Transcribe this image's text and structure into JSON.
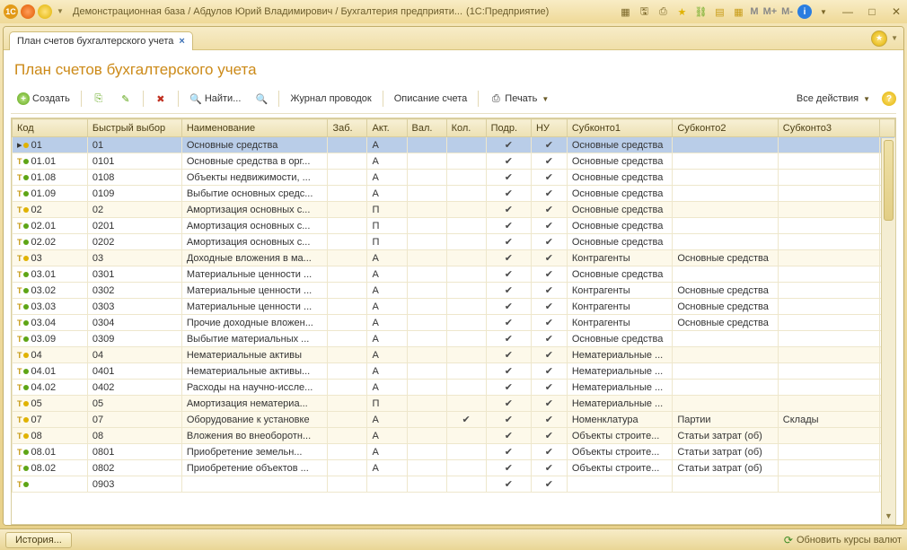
{
  "window": {
    "title": "Демонстрационная база / Абдулов Юрий Владимирович / Бухгалтерия предприяти...",
    "suffix": "(1С:Предприятие)",
    "mem": {
      "m": "M",
      "mplus": "M+",
      "mminus": "M-"
    }
  },
  "tab": {
    "label": "План счетов бухгалтерского учета"
  },
  "page": {
    "title": "План счетов бухгалтерского учета"
  },
  "toolbar": {
    "create": "Создать",
    "find": "Найти...",
    "journal": "Журнал проводок",
    "desc": "Описание счета",
    "print": "Печать",
    "all_actions": "Все действия"
  },
  "columns": [
    "Код",
    "Быстрый выбор",
    "Наименование",
    "Заб.",
    "Акт.",
    "Вал.",
    "Кол.",
    "Подр.",
    "НУ",
    "Субконто1",
    "Субконто2",
    "Субконто3"
  ],
  "rows": [
    {
      "sel": true,
      "lvl": 0,
      "code": "01",
      "q": "01",
      "name": "Основные средства",
      "akt": "А",
      "val": "",
      "kol": "",
      "podr": true,
      "nu": true,
      "s1": "Основные средства",
      "s2": "",
      "s3": ""
    },
    {
      "lvl": 1,
      "code": "01.01",
      "q": "0101",
      "name": "Основные средства в орг...",
      "akt": "А",
      "val": "",
      "kol": "",
      "podr": true,
      "nu": true,
      "s1": "Основные средства",
      "s2": "",
      "s3": ""
    },
    {
      "lvl": 1,
      "code": "01.08",
      "q": "0108",
      "name": "Объекты недвижимости, ...",
      "akt": "А",
      "val": "",
      "kol": "",
      "podr": true,
      "nu": true,
      "s1": "Основные средства",
      "s2": "",
      "s3": ""
    },
    {
      "lvl": 1,
      "code": "01.09",
      "q": "0109",
      "name": "Выбытие основных средс...",
      "akt": "А",
      "val": "",
      "kol": "",
      "podr": true,
      "nu": true,
      "s1": "Основные средства",
      "s2": "",
      "s3": ""
    },
    {
      "lvl": 0,
      "code": "02",
      "q": "02",
      "name": "Амортизация основных с...",
      "akt": "П",
      "val": "",
      "kol": "",
      "podr": true,
      "nu": true,
      "s1": "Основные средства",
      "s2": "",
      "s3": ""
    },
    {
      "lvl": 1,
      "code": "02.01",
      "q": "0201",
      "name": "Амортизация основных с...",
      "akt": "П",
      "val": "",
      "kol": "",
      "podr": true,
      "nu": true,
      "s1": "Основные средства",
      "s2": "",
      "s3": ""
    },
    {
      "lvl": 1,
      "code": "02.02",
      "q": "0202",
      "name": "Амортизация основных с...",
      "akt": "П",
      "val": "",
      "kol": "",
      "podr": true,
      "nu": true,
      "s1": "Основные средства",
      "s2": "",
      "s3": ""
    },
    {
      "lvl": 0,
      "code": "03",
      "q": "03",
      "name": "Доходные вложения в ма...",
      "akt": "А",
      "val": "",
      "kol": "",
      "podr": true,
      "nu": true,
      "s1": "Контрагенты",
      "s2": "Основные средства",
      "s3": ""
    },
    {
      "lvl": 1,
      "code": "03.01",
      "q": "0301",
      "name": "Материальные ценности ...",
      "akt": "А",
      "val": "",
      "kol": "",
      "podr": true,
      "nu": true,
      "s1": "Основные средства",
      "s2": "",
      "s3": ""
    },
    {
      "lvl": 1,
      "code": "03.02",
      "q": "0302",
      "name": "Материальные ценности ...",
      "akt": "А",
      "val": "",
      "kol": "",
      "podr": true,
      "nu": true,
      "s1": "Контрагенты",
      "s2": "Основные средства",
      "s3": ""
    },
    {
      "lvl": 1,
      "code": "03.03",
      "q": "0303",
      "name": "Материальные ценности ...",
      "akt": "А",
      "val": "",
      "kol": "",
      "podr": true,
      "nu": true,
      "s1": "Контрагенты",
      "s2": "Основные средства",
      "s3": ""
    },
    {
      "lvl": 1,
      "code": "03.04",
      "q": "0304",
      "name": "Прочие доходные вложен...",
      "akt": "А",
      "val": "",
      "kol": "",
      "podr": true,
      "nu": true,
      "s1": "Контрагенты",
      "s2": "Основные средства",
      "s3": ""
    },
    {
      "lvl": 1,
      "code": "03.09",
      "q": "0309",
      "name": "Выбытие материальных ...",
      "akt": "А",
      "val": "",
      "kol": "",
      "podr": true,
      "nu": true,
      "s1": "Основные средства",
      "s2": "",
      "s3": ""
    },
    {
      "lvl": 0,
      "code": "04",
      "q": "04",
      "name": "Нематериальные активы",
      "akt": "А",
      "val": "",
      "kol": "",
      "podr": true,
      "nu": true,
      "s1": "Нематериальные ...",
      "s2": "",
      "s3": ""
    },
    {
      "lvl": 1,
      "code": "04.01",
      "q": "0401",
      "name": "Нематериальные активы...",
      "akt": "А",
      "val": "",
      "kol": "",
      "podr": true,
      "nu": true,
      "s1": "Нематериальные ...",
      "s2": "",
      "s3": ""
    },
    {
      "lvl": 1,
      "code": "04.02",
      "q": "0402",
      "name": "Расходы на научно-иссле...",
      "akt": "А",
      "val": "",
      "kol": "",
      "podr": true,
      "nu": true,
      "s1": "Нематериальные ...",
      "s2": "",
      "s3": ""
    },
    {
      "lvl": 0,
      "code": "05",
      "q": "05",
      "name": "Амортизация нематериа...",
      "akt": "П",
      "val": "",
      "kol": "",
      "podr": true,
      "nu": true,
      "s1": "Нематериальные ...",
      "s2": "",
      "s3": ""
    },
    {
      "lvl": 0,
      "code": "07",
      "q": "07",
      "name": "Оборудование к установке",
      "akt": "А",
      "val": "",
      "kol": true,
      "podr": true,
      "nu": true,
      "s1": "Номенклатура",
      "s2": "Партии",
      "s3": "Склады"
    },
    {
      "lvl": 0,
      "code": "08",
      "q": "08",
      "name": "Вложения во внеоборотн...",
      "akt": "А",
      "val": "",
      "kol": "",
      "podr": true,
      "nu": true,
      "s1": "Объекты строите...",
      "s2": "Статьи затрат (об)",
      "s3": ""
    },
    {
      "lvl": 1,
      "code": "08.01",
      "q": "0801",
      "name": "Приобретение земельн...",
      "akt": "А",
      "val": "",
      "kol": "",
      "podr": true,
      "nu": true,
      "s1": "Объекты строите...",
      "s2": "Статьи затрат (об)",
      "s3": ""
    },
    {
      "lvl": 1,
      "code": "08.02",
      "q": "0802",
      "name": "Приобретение объектов ...",
      "akt": "А",
      "val": "",
      "kol": "",
      "podr": true,
      "nu": true,
      "s1": "Объекты строите...",
      "s2": "Статьи затрат (об)",
      "s3": ""
    },
    {
      "lvl": 1,
      "cut": true,
      "code": "",
      "q": "0903",
      "name": "",
      "akt": "",
      "val": "",
      "kol": "",
      "podr": true,
      "nu": true,
      "s1": "",
      "s2": "",
      "s3": ""
    }
  ],
  "status": {
    "history": "История...",
    "refresh": "Обновить курсы валют"
  }
}
